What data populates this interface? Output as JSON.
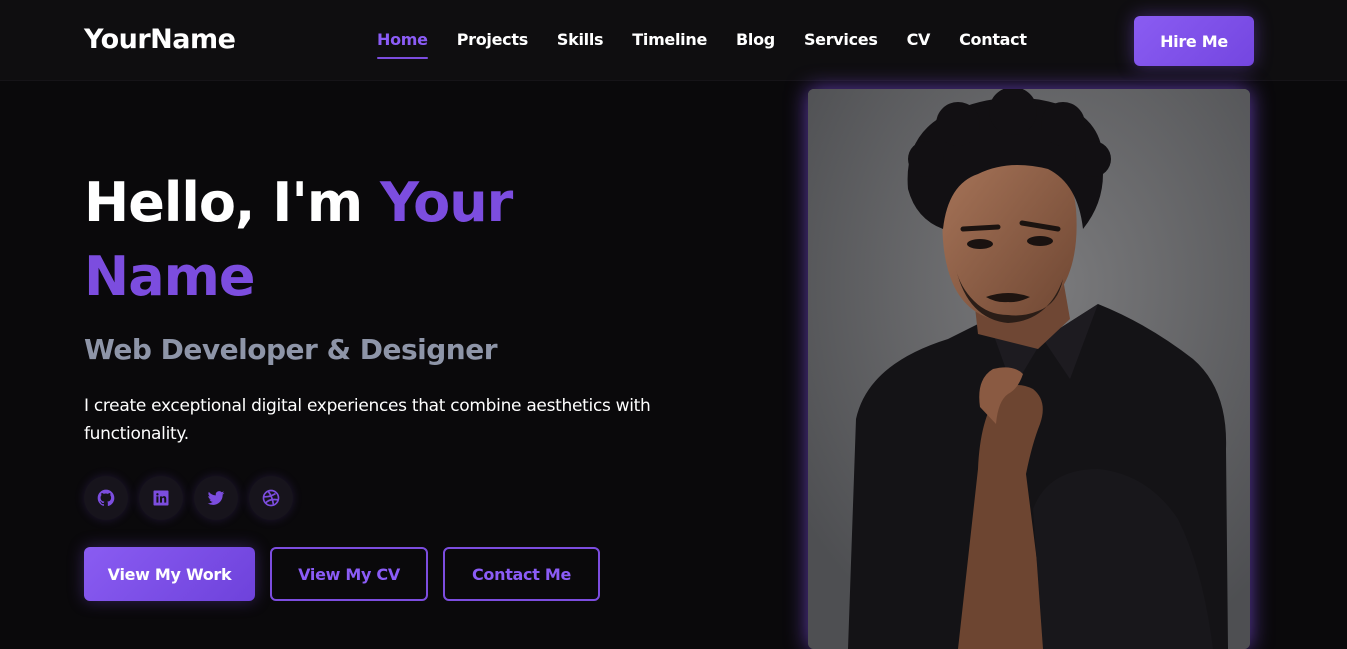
{
  "header": {
    "logo": "YourName",
    "nav": [
      {
        "label": "Home",
        "active": true
      },
      {
        "label": "Projects"
      },
      {
        "label": "Skills"
      },
      {
        "label": "Timeline"
      },
      {
        "label": "Blog"
      },
      {
        "label": "Services"
      },
      {
        "label": "CV"
      },
      {
        "label": "Contact"
      }
    ],
    "cta_label": "Hire Me"
  },
  "hero": {
    "greeting": "Hello, I'm ",
    "name_highlight": "Your Name",
    "subtitle": "Web Developer & Designer",
    "description": "I create exceptional digital experiences that combine aesthetics with functionality.",
    "socials": [
      {
        "icon": "github-icon"
      },
      {
        "icon": "linkedin-icon"
      },
      {
        "icon": "twitter-icon"
      },
      {
        "icon": "dribbble-icon"
      }
    ],
    "buttons": {
      "primary": "View My Work",
      "cv": "View My CV",
      "contact": "Contact Me"
    }
  },
  "colors": {
    "accent": "#7c4ddf",
    "background": "#0a090b",
    "subtitle": "#8e95a8"
  }
}
